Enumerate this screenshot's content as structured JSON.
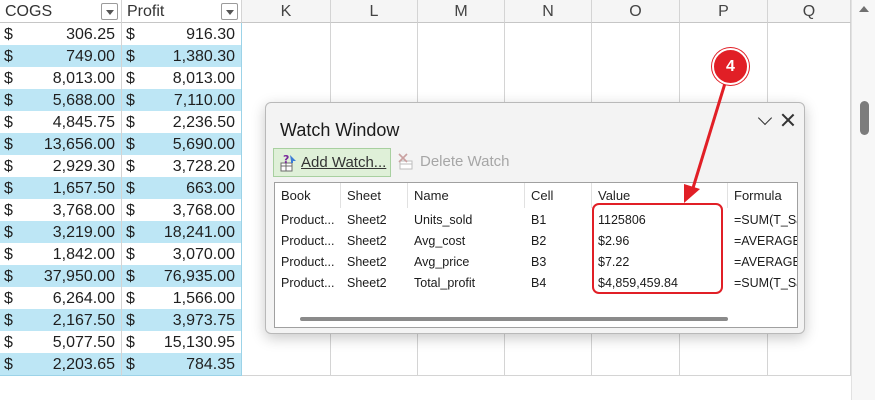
{
  "columns": {
    "table_headers": [
      "COGS",
      "Profit"
    ],
    "letters": [
      "K",
      "L",
      "M",
      "N",
      "O",
      "P",
      "Q"
    ]
  },
  "rows": [
    {
      "cogs": "306.25",
      "profit": "916.30"
    },
    {
      "cogs": "749.00",
      "profit": "1,380.30"
    },
    {
      "cogs": "8,013.00",
      "profit": "8,013.00"
    },
    {
      "cogs": "5,688.00",
      "profit": "7,110.00"
    },
    {
      "cogs": "4,845.75",
      "profit": "2,236.50"
    },
    {
      "cogs": "13,656.00",
      "profit": "5,690.00"
    },
    {
      "cogs": "2,929.30",
      "profit": "3,728.20"
    },
    {
      "cogs": "1,657.50",
      "profit": "663.00"
    },
    {
      "cogs": "3,768.00",
      "profit": "3,768.00"
    },
    {
      "cogs": "3,219.00",
      "profit": "18,241.00"
    },
    {
      "cogs": "1,842.00",
      "profit": "3,070.00"
    },
    {
      "cogs": "37,950.00",
      "profit": "76,935.00"
    },
    {
      "cogs": "6,264.00",
      "profit": "1,566.00"
    },
    {
      "cogs": "2,167.50",
      "profit": "3,973.75"
    },
    {
      "cogs": "5,077.50",
      "profit": "15,130.95"
    },
    {
      "cogs": "2,203.65",
      "profit": "784.35"
    }
  ],
  "currency_symbol": "$",
  "watch_window": {
    "title": "Watch Window",
    "add_watch_label": "Add Watch...",
    "delete_watch_label": "Delete Watch",
    "headers": [
      "Book",
      "Sheet",
      "Name",
      "Cell",
      "Value",
      "Formula"
    ],
    "entries": [
      {
        "book": "Product...",
        "sheet": "Sheet2",
        "name": "Units_sold",
        "cell": "B1",
        "value": "1125806",
        "formula": "=SUM(T_Sa"
      },
      {
        "book": "Product...",
        "sheet": "Sheet2",
        "name": "Avg_cost",
        "cell": "B2",
        "value": " $2.96",
        "formula": "=AVERAGE"
      },
      {
        "book": "Product...",
        "sheet": "Sheet2",
        "name": "Avg_price",
        "cell": "B3",
        "value": " $7.22",
        "formula": "=AVERAGE"
      },
      {
        "book": "Product...",
        "sheet": "Sheet2",
        "name": "Total_profit",
        "cell": "B4",
        "value": " $4,859,459.84",
        "formula": "=SUM(T_Sa"
      }
    ]
  },
  "annotation": {
    "number": "4",
    "color": "#e11f26"
  },
  "colors": {
    "band": "#bde6f5",
    "add_watch_bg": "#dff0d8"
  }
}
